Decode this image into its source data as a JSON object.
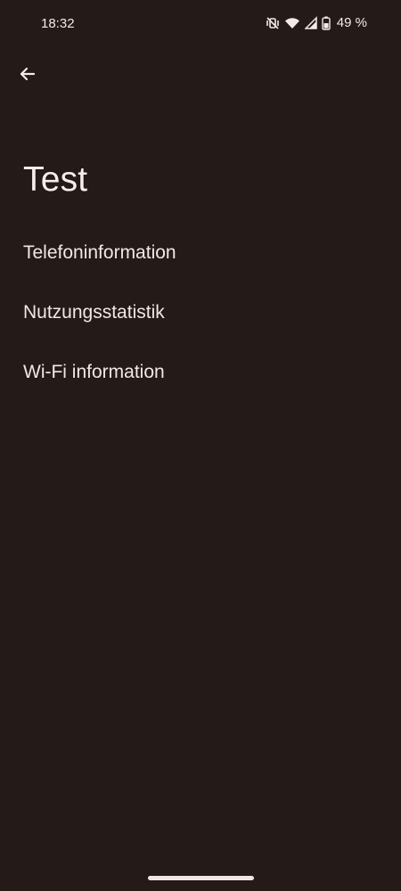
{
  "status_bar": {
    "time": "18:32",
    "battery": "49 %",
    "icons": [
      "vibrate-off-icon",
      "wifi-icon",
      "signal-icon",
      "battery-icon"
    ]
  },
  "header": {
    "back_icon": "arrow-left-icon"
  },
  "page": {
    "title": "Test"
  },
  "menu": {
    "items": [
      {
        "label": "Telefoninformation"
      },
      {
        "label": "Nutzungsstatistik"
      },
      {
        "label": "Wi-Fi information"
      }
    ]
  },
  "colors": {
    "background": "#241a17",
    "text": "#efe6e2"
  }
}
